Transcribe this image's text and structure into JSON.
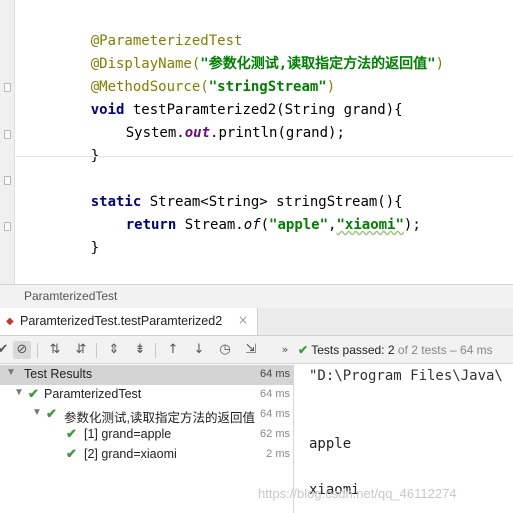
{
  "editor": {
    "lines": {
      "l1_ann": "@ParameterizedTest",
      "l2_ann": "@DisplayName(",
      "l2_str": "\"参数化测试,读取指定方法的返回值\"",
      "l2_close": ")",
      "l3_ann": "@MethodSource(",
      "l3_str": "\"stringStream\"",
      "l3_close": ")",
      "l4_kw": "void",
      "l4_rest": " testParamterized2(String grand){",
      "l5_pre": "System.",
      "l5_field": "out",
      "l5_post": ".println(grand);",
      "l6": "}",
      "l7_kw": "static",
      "l7_rest": " Stream<String> stringStream(){",
      "l8_kw": "return",
      "l8_pre": " Stream.",
      "l8_ital": "of",
      "l8_open": "(",
      "l8_s1": "\"apple\"",
      "l8_comma": ",",
      "l8_s2": "\"xiaomi\"",
      "l8_close": ");",
      "l9": "}"
    }
  },
  "run_panel": {
    "title": "ParamterizedTest",
    "tab_label": "ParamterizedTest.testParamterized2",
    "tab_close": "×",
    "status": {
      "prefix": "Tests passed: ",
      "passed": "2",
      "suffix": " of 2 tests – 64 ms"
    },
    "tree": [
      {
        "label": "Test Results",
        "time": "64 ms"
      },
      {
        "label": "ParamterizedTest",
        "time": "64 ms"
      },
      {
        "label": "参数化测试,读取指定方法的返回值",
        "time": "64 ms"
      },
      {
        "label": "[1] grand=apple",
        "time": "62 ms"
      },
      {
        "label": "[2] grand=xiaomi",
        "time": "2 ms"
      }
    ],
    "console": {
      "path": "\"D:\\Program Files\\Java\\",
      "out1": "apple",
      "out2": "xiaomi"
    }
  },
  "watermark": "https://blog.csdn.net/qq_46112274",
  "colors": {
    "annotation": "#808000",
    "keyword": "#000080",
    "string": "#008000",
    "pass": "#3d9a3d"
  },
  "icons": [
    "rerun-icon",
    "stop-icon",
    "sort-alpha-icon",
    "sort-duration-icon",
    "expand-all-icon",
    "collapse-all-icon",
    "prev-failed-icon",
    "next-failed-icon",
    "history-icon",
    "export-icon",
    "pass-check-icon",
    "expand-arrow-icon",
    "close-icon"
  ]
}
